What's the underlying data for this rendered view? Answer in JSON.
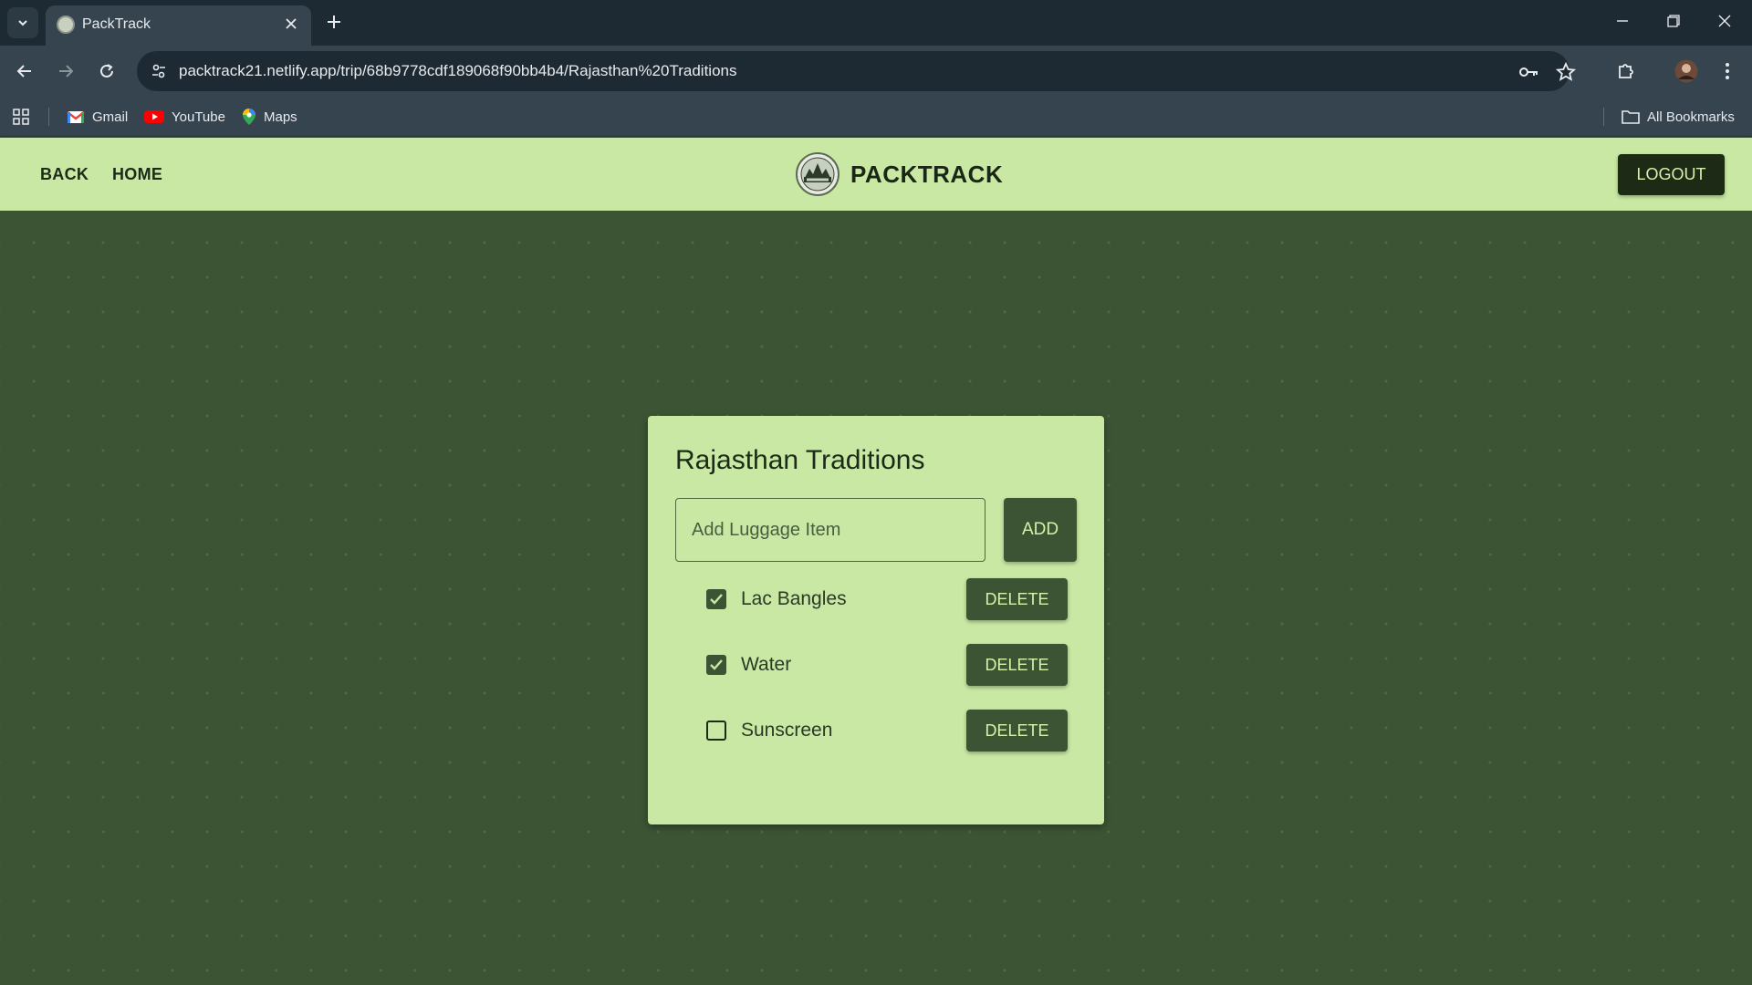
{
  "browser": {
    "tab_title": "PackTrack",
    "url": "packtrack21.netlify.app/trip/68b9778cdf189068f90bb4b4/Rajasthan%20Traditions",
    "bookmarks": [
      {
        "label": "Gmail",
        "icon": "gmail-icon"
      },
      {
        "label": "YouTube",
        "icon": "youtube-icon"
      },
      {
        "label": "Maps",
        "icon": "maps-icon"
      }
    ],
    "all_bookmarks_label": "All Bookmarks"
  },
  "header": {
    "back_label": "BACK",
    "home_label": "HOME",
    "brand_name": "PACKTRACK",
    "logout_label": "LOGOUT"
  },
  "trip": {
    "title": "Rajasthan Traditions",
    "input_placeholder": "Add Luggage Item",
    "add_label": "ADD",
    "items": [
      {
        "label": "Lac Bangles",
        "checked": true,
        "delete_label": "DELETE"
      },
      {
        "label": "Water",
        "checked": true,
        "delete_label": "DELETE"
      },
      {
        "label": "Sunscreen",
        "checked": false,
        "delete_label": "DELETE"
      }
    ]
  },
  "colors": {
    "header_bg": "#c9e8a4",
    "page_bg": "#3c5434",
    "button_bg": "#3c5434",
    "button_text": "#d6f2a8",
    "logout_bg": "#1d2b16"
  }
}
